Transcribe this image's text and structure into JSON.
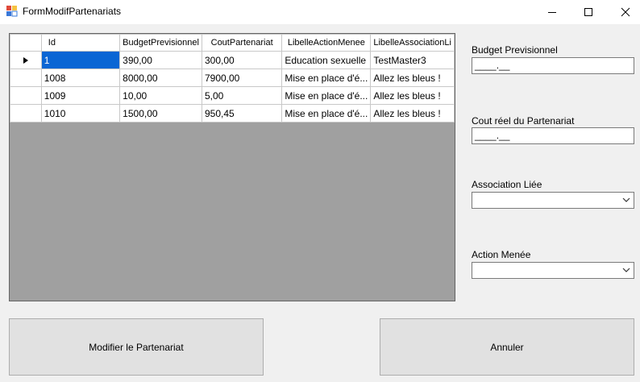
{
  "window": {
    "title": "FormModifPartenariats"
  },
  "grid": {
    "columns": [
      "Id",
      "BudgetPrevisionnel",
      "CoutPartenariat",
      "LibelleActionMenee",
      "LibelleAssociationLi"
    ],
    "rows": [
      {
        "current": true,
        "cells": [
          "1",
          "390,00",
          "300,00",
          "Education sexuelle",
          "TestMaster3"
        ]
      },
      {
        "current": false,
        "cells": [
          "1008",
          "8000,00",
          "7900,00",
          "Mise en place d'é...",
          "Allez les bleus !"
        ]
      },
      {
        "current": false,
        "cells": [
          "1009",
          "10,00",
          "5,00",
          "Mise en place d'é...",
          "Allez les bleus !"
        ]
      },
      {
        "current": false,
        "cells": [
          "1010",
          "1500,00",
          "950,45",
          "Mise en place d'é...",
          "Allez les bleus !"
        ]
      }
    ],
    "selection_color": "#0a66d4"
  },
  "form": {
    "budget_label": "Budget Previsionnel",
    "budget_value": "____.__",
    "cout_label": "Cout réel du Partenariat",
    "cout_value": "____.__",
    "association_label": "Association Liée",
    "association_value": "",
    "action_label": "Action Menée",
    "action_value": ""
  },
  "buttons": {
    "modifier": "Modifier le Partenariat",
    "annuler": "Annuler"
  }
}
